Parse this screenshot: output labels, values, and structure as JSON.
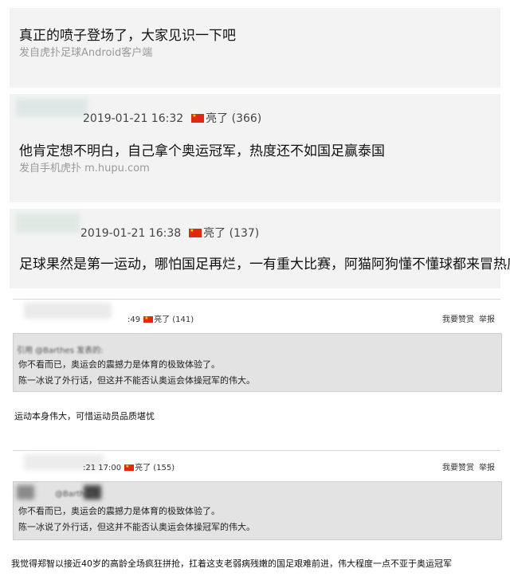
{
  "post": {
    "title": "真正的喷子登场了，大家见识一下吧",
    "source": "发自虎扑足球Android客户端"
  },
  "replies": [
    {
      "timestamp": "2019-01-21 16:32",
      "user_label": "亮了",
      "count": "(366)",
      "body": "他肯定想不明白，自己拿个奥运冠军，热度还不如国足赢泰国",
      "source": "发自手机虎扑 m.hupu.com"
    },
    {
      "timestamp": "2019-01-21 16:38",
      "user_label": "亮了",
      "count": "(137)",
      "body": "足球果然是第一运动，哪怕国足再烂，一有重大比赛，阿猫阿狗懂不懂球都来冒热度了"
    },
    {
      "time_partial": ":49",
      "user_label": "亮了",
      "count": "(141)",
      "actions": [
        "我要赞赏",
        "举报"
      ],
      "quote_head": "引用 @Barthes 发表的:",
      "quote_lines": [
        "你不看而已，奥运会的震撼力是体育的极致体验了。",
        "陈一冰说了外行话，但这并不能否认奥运会体操冠军的伟大。"
      ],
      "body": "运动本身伟大，可惜运动员品质堪忧"
    },
    {
      "time_partial": ":21 17:00",
      "user_label": "亮了",
      "count": "(155)",
      "actions": [
        "我要赞赏",
        "举报"
      ],
      "quote_head": "@Barthes",
      "quote_lines": [
        "你不看而已，奥运会的震撼力是体育的极致体验了。",
        "陈一冰说了外行话，但这并不能否认奥运会体操冠军的伟大。"
      ],
      "body": "我觉得郑智以接近40岁的高龄全场疯狂拼抢，扛着这支老弱病残嫩的国足艰难前进，伟大程度一点不亚于奥运冠军"
    }
  ]
}
